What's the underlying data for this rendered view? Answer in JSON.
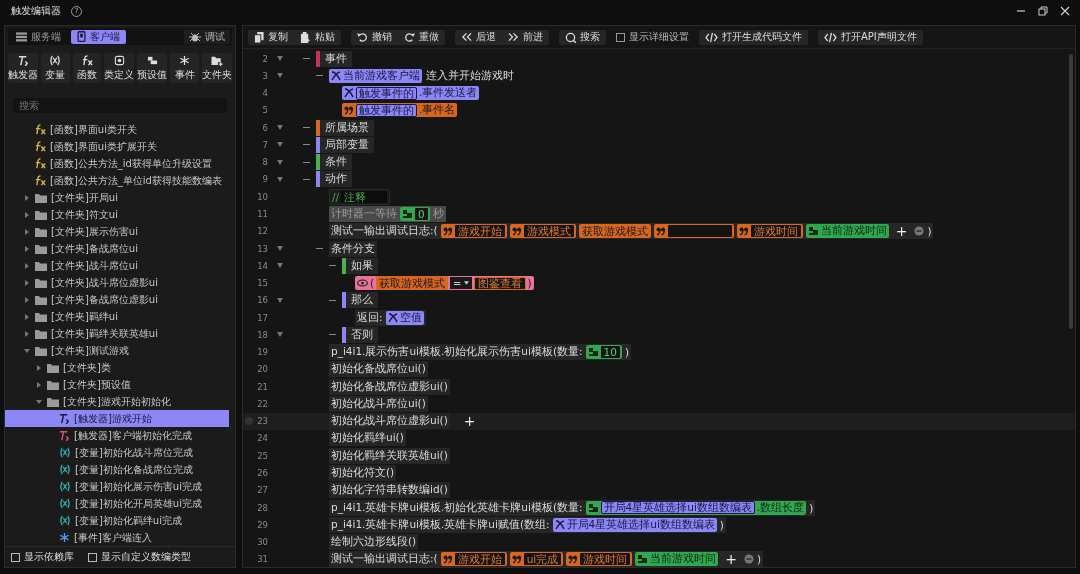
{
  "window": {
    "title": "触发编辑器",
    "help": "?"
  },
  "sidebar": {
    "tabs": [
      {
        "label": "服务端",
        "kind": "server",
        "selected": false
      },
      {
        "label": "客户端",
        "kind": "client",
        "selected": true
      }
    ],
    "debug_button": "调试",
    "palette": [
      {
        "label": "触发器",
        "kind": "trigger"
      },
      {
        "label": "变量",
        "kind": "variable"
      },
      {
        "label": "函数",
        "kind": "function"
      },
      {
        "label": "类定义",
        "kind": "class"
      },
      {
        "label": "预设值",
        "kind": "preset"
      },
      {
        "label": "事件",
        "kind": "event"
      },
      {
        "label": "文件夹",
        "kind": "folder"
      }
    ],
    "search": {
      "placeholder": "搜索"
    },
    "tree": [
      {
        "kind": "function",
        "label": "[函数]界面ui类开关",
        "selected": false
      },
      {
        "kind": "function",
        "label": "[函数]界面ui类扩展开关",
        "selected": false
      },
      {
        "kind": "function",
        "label": "[函数]公共方法_id获得单位升级设置",
        "selected": false
      },
      {
        "kind": "function",
        "label": "[函数]公共方法_单位id获得技能数编表",
        "selected": false
      },
      {
        "kind": "folder",
        "label": "[文件夹]开局ui",
        "expanded": false,
        "selected": false
      },
      {
        "kind": "folder",
        "label": "[文件夹]符文ui",
        "expanded": false,
        "selected": false
      },
      {
        "kind": "folder",
        "label": "[文件夹]展示伤害ui",
        "expanded": false,
        "selected": false
      },
      {
        "kind": "folder",
        "label": "[文件夹]备战席位ui",
        "expanded": false,
        "selected": false
      },
      {
        "kind": "folder",
        "label": "[文件夹]战斗席位ui",
        "expanded": false,
        "selected": false
      },
      {
        "kind": "folder",
        "label": "[文件夹]战斗席位虚影ui",
        "expanded": false,
        "selected": false
      },
      {
        "kind": "folder",
        "label": "[文件夹]备战席位虚影ui",
        "expanded": false,
        "selected": false
      },
      {
        "kind": "folder",
        "label": "[文件夹]羁绊ui",
        "expanded": false,
        "selected": false
      },
      {
        "kind": "folder",
        "label": "[文件夹]羁绊关联英雄ui",
        "expanded": false,
        "selected": false
      },
      {
        "kind": "folder",
        "label": "[文件夹]测试游戏",
        "expanded": true,
        "selected": false,
        "children": [
          {
            "kind": "folder",
            "label": "[文件夹]类",
            "expanded": false,
            "selected": false
          },
          {
            "kind": "folder",
            "label": "[文件夹]预设值",
            "expanded": false,
            "selected": false
          },
          {
            "kind": "folder",
            "label": "[文件夹]游戏开始初始化",
            "expanded": true,
            "selected": false,
            "children": [
              {
                "kind": "trigger",
                "label": "[触发器]游戏开始",
                "selected": true
              },
              {
                "kind": "trigger",
                "label": "[触发器]客户端初始化完成",
                "selected": false
              },
              {
                "kind": "variable",
                "label": "[变量]初始化战斗席位完成",
                "selected": false
              },
              {
                "kind": "variable",
                "label": "[变量]初始化备战席位完成",
                "selected": false
              },
              {
                "kind": "variable",
                "label": "[变量]初始化展示伤害ui完成",
                "selected": false
              },
              {
                "kind": "variable",
                "label": "[变量]初始化开局英雄ui完成",
                "selected": false
              },
              {
                "kind": "variable",
                "label": "[变量]初始化羁绊ui完成",
                "selected": false
              },
              {
                "kind": "event",
                "label": "[事件]客户端连入",
                "selected": false
              }
            ]
          }
        ]
      }
    ],
    "options": [
      {
        "label": "显示依赖库",
        "checked": false
      },
      {
        "label": "显示自定义数编类型",
        "checked": false
      }
    ]
  },
  "toolbar": [
    [
      {
        "kind": "copy",
        "label": "复制"
      },
      {
        "kind": "paste",
        "label": "粘贴"
      }
    ],
    [
      {
        "kind": "undo",
        "label": "撤销"
      },
      {
        "kind": "redo",
        "label": "重做"
      }
    ],
    [
      {
        "kind": "back",
        "label": "后退"
      },
      {
        "kind": "forward",
        "label": "前进"
      }
    ],
    [
      {
        "kind": "search",
        "label": "搜索"
      }
    ],
    [
      {
        "kind": "check",
        "label": "显示详细设置",
        "checked": false
      }
    ],
    [
      {
        "kind": "code",
        "label": "打开生成代码文件"
      }
    ],
    [
      {
        "kind": "code",
        "label": "打开API声明文件"
      }
    ]
  ],
  "lines": [
    {
      "number": "2",
      "foldable": true,
      "selected": false,
      "parts": [
        {
          "kind": "block",
          "label": "事件",
          "color": "#c8324f"
        }
      ],
      "children": [
        {
          "number": "3",
          "foldable": true,
          "selected": false,
          "parts": [
            {
              "kind": "var",
              "label": "当前游戏客户端"
            },
            {
              "kind": "text",
              "label": "连入并开始游戏时"
            }
          ],
          "children": [
            {
              "number": "4",
              "foldable": false,
              "selected": false,
              "parts": [
                {
                  "kind": "var",
                  "inner": "触发事件的",
                  "label": ".事件发送者"
                }
              ]
            },
            {
              "number": "5",
              "foldable": false,
              "selected": false,
              "parts": [
                {
                  "kind": "str",
                  "inner": "触发事件的",
                  "label": ".事件名"
                }
              ]
            }
          ]
        }
      ]
    },
    {
      "number": "6",
      "foldable": true,
      "selected": false,
      "parts": [
        {
          "kind": "block",
          "label": "所属场景",
          "color": "#e0651c"
        }
      ]
    },
    {
      "number": "7",
      "foldable": true,
      "selected": false,
      "parts": [
        {
          "kind": "block",
          "label": "局部变量",
          "color": "#8c86f6"
        }
      ]
    },
    {
      "number": "8",
      "foldable": true,
      "selected": false,
      "parts": [
        {
          "kind": "block",
          "label": "条件",
          "color": "#4caf50"
        }
      ]
    },
    {
      "number": "9",
      "foldable": true,
      "selected": false,
      "parts": [
        {
          "kind": "block",
          "label": "动作",
          "color": "#8c86f6"
        }
      ],
      "children": [
        {
          "number": "10",
          "foldable": false,
          "selected": false,
          "parts": [
            {
              "kind": "comment",
              "mark": "//",
              "label": "注释"
            }
          ]
        },
        {
          "number": "11",
          "foldable": false,
          "selected": false,
          "parts": [
            {
              "kind": "dim",
              "label": "计时器一等待"
            },
            {
              "kind": "num",
              "label": "0"
            },
            {
              "kind": "dim",
              "label": "秒"
            }
          ]
        },
        {
          "number": "12",
          "foldable": false,
          "selected": false,
          "parts": [
            {
              "kind": "text",
              "label": "测试一输出调试日志:("
            },
            {
              "kind": "str",
              "label": "游戏开始"
            },
            {
              "kind": "str",
              "label": "游戏模式"
            },
            {
              "kind": "call",
              "label": "获取游戏模式"
            },
            {
              "kind": "str"
            },
            {
              "kind": "str",
              "label": "游戏时间"
            },
            {
              "kind": "numcall",
              "label": "当前游戏时间"
            },
            {
              "kind": "add",
              "label": "+"
            },
            {
              "kind": "remove"
            },
            {
              "kind": "text",
              "label": ")"
            }
          ]
        },
        {
          "number": "13",
          "foldable": true,
          "selected": false,
          "parts": [
            {
              "kind": "text",
              "label": "条件分支"
            }
          ],
          "children": [
            {
              "number": "14",
              "foldable": true,
              "selected": false,
              "parts": [
                {
                  "kind": "block",
                  "label": "如果",
                  "color": "#4caf50"
                }
              ],
              "children": [
                {
                  "number": "15",
                  "foldable": false,
                  "selected": false,
                  "parts": [
                    {
                      "kind": "cond",
                      "open": "(",
                      "close": ")",
                      "parts": [
                        {
                          "kind": "call",
                          "label": "获取游戏模式"
                        },
                        {
                          "kind": "op",
                          "label": "="
                        },
                        {
                          "kind": "strbox",
                          "label": "图鉴查看"
                        }
                      ]
                    }
                  ]
                }
              ]
            },
            {
              "number": "16",
              "foldable": true,
              "selected": false,
              "parts": [
                {
                  "kind": "block",
                  "label": "那么",
                  "color": "#8c86f6"
                }
              ],
              "children": [
                {
                  "number": "17",
                  "foldable": false,
                  "selected": false,
                  "parts": [
                    {
                      "kind": "text",
                      "label": "返回:"
                    },
                    {
                      "kind": "var",
                      "label": "空值"
                    }
                  ]
                }
              ]
            },
            {
              "number": "18",
              "foldable": true,
              "selected": false,
              "parts": [
                {
                  "kind": "block",
                  "label": "否则",
                  "color": "#8c86f6"
                }
              ]
            }
          ]
        },
        {
          "number": "19",
          "foldable": false,
          "selected": false,
          "parts": [
            {
              "kind": "text",
              "label": "p_i4i1.展示伤害ui模板.初始化展示伤害ui模板(数量:"
            },
            {
              "kind": "num",
              "label": "10"
            },
            {
              "kind": "text",
              "label": ")"
            }
          ]
        },
        {
          "number": "20",
          "foldable": false,
          "selected": false,
          "parts": [
            {
              "kind": "text",
              "label": "初始化备战席位ui()"
            }
          ]
        },
        {
          "number": "21",
          "foldable": false,
          "selected": false,
          "parts": [
            {
              "kind": "text",
              "label": "初始化备战席位虚影ui()"
            }
          ]
        },
        {
          "number": "22",
          "foldable": false,
          "selected": false,
          "parts": [
            {
              "kind": "text",
              "label": "初始化战斗席位ui()"
            }
          ]
        },
        {
          "number": "23",
          "foldable": false,
          "selected": true,
          "add": "+",
          "parts": [
            {
              "kind": "text",
              "label": "初始化战斗席位虚影ui()"
            }
          ]
        },
        {
          "number": "24",
          "foldable": false,
          "selected": false,
          "parts": [
            {
              "kind": "text",
              "label": "初始化羁绊ui()"
            }
          ]
        },
        {
          "number": "25",
          "foldable": false,
          "selected": false,
          "parts": [
            {
              "kind": "text",
              "label": "初始化羁绊关联英雄ui()"
            }
          ]
        },
        {
          "number": "26",
          "foldable": false,
          "selected": false,
          "parts": [
            {
              "kind": "text",
              "label": "初始化符文()"
            }
          ]
        },
        {
          "number": "27",
          "foldable": false,
          "selected": false,
          "parts": [
            {
              "kind": "text",
              "label": "初始化字符串转数编id()"
            }
          ]
        },
        {
          "number": "28",
          "foldable": false,
          "selected": false,
          "parts": [
            {
              "kind": "text",
              "label": "p_i4i1.英雄卡牌ui模板.初始化英雄卡牌ui模板(数量:"
            },
            {
              "kind": "numcall",
              "inner": "开局4星英雄选择ui数组数编表",
              "label": ".数组长度"
            },
            {
              "kind": "text",
              "label": ")"
            }
          ]
        },
        {
          "number": "29",
          "foldable": false,
          "selected": false,
          "parts": [
            {
              "kind": "text",
              "label": "p_i4i1.英雄卡牌ui模板.英雄卡牌ui赋值(数组:"
            },
            {
              "kind": "var",
              "label": "开局4星英雄选择ui数组数编表"
            },
            {
              "kind": "text",
              "label": ")"
            }
          ]
        },
        {
          "number": "30",
          "foldable": false,
          "selected": false,
          "parts": [
            {
              "kind": "text",
              "label": "绘制六边形线段()"
            }
          ]
        },
        {
          "number": "31",
          "foldable": false,
          "selected": false,
          "parts": [
            {
              "kind": "text",
              "label": "测试一输出调试日志:("
            },
            {
              "kind": "str",
              "label": "游戏开始"
            },
            {
              "kind": "str",
              "label": "ui完成"
            },
            {
              "kind": "str",
              "label": "游戏时间"
            },
            {
              "kind": "numcall",
              "label": "当前游戏时间"
            },
            {
              "kind": "add",
              "label": "+"
            },
            {
              "kind": "remove"
            },
            {
              "kind": "text",
              "label": ")"
            }
          ]
        }
      ]
    }
  ]
}
